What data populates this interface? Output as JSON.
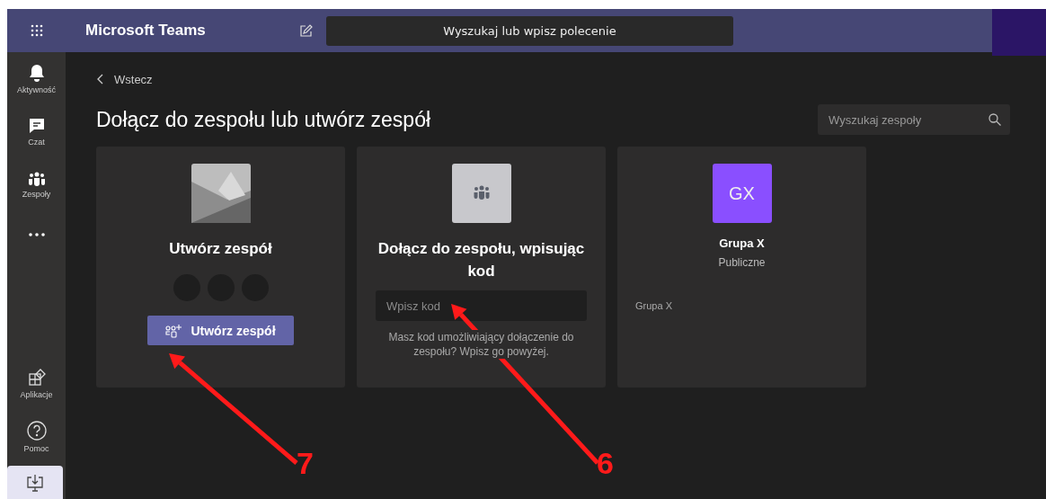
{
  "header": {
    "title": "Microsoft Teams",
    "search": {
      "placeholder": "Wyszukaj lub wpisz polecenie"
    }
  },
  "sidebar": {
    "items": [
      {
        "kind": "bell",
        "label": "Aktywność"
      },
      {
        "kind": "chat",
        "label": "Czat"
      },
      {
        "kind": "teams",
        "label": "Zespoły"
      },
      {
        "kind": "more"
      }
    ],
    "bottom_items": [
      {
        "kind": "apps",
        "label": "Aplikacje"
      },
      {
        "kind": "help",
        "label": "Pomoc"
      },
      {
        "kind": "download"
      }
    ]
  },
  "back_link": "Wstecz",
  "heading": "Dołącz do zespołu lub utwórz zespół",
  "team_search": {
    "placeholder": "Wyszukaj zespoły"
  },
  "cards": [
    {
      "kind": "create",
      "title": "Utwórz zespół",
      "button": "Utwórz zespół"
    },
    {
      "kind": "join",
      "title": "Dołącz do zespołu, wpisując kod",
      "input": {
        "placeholder": "Wpisz kod"
      },
      "help": "Masz kod umożliwiający dołączenie do zespołu? Wpisz go powyżej."
    },
    {
      "kind": "team",
      "avatar": "GX",
      "title": "Grupa X",
      "visibility": "Publiczne",
      "description": "Grupa X"
    }
  ],
  "annotations": [
    {
      "label": "7"
    },
    {
      "label": "6"
    }
  ]
}
